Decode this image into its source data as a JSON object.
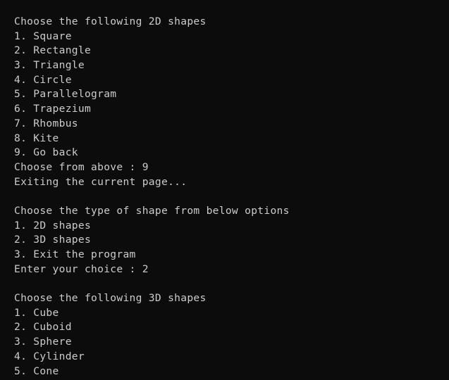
{
  "terminal": {
    "lines": [
      "Choose the following 2D shapes",
      "1. Square",
      "2. Rectangle",
      "3. Triangle",
      "4. Circle",
      "5. Parallelogram",
      "6. Trapezium",
      "7. Rhombus",
      "8. Kite",
      "9. Go back",
      "Choose from above : 9",
      "Exiting the current page...",
      "",
      "Choose the type of shape from below options",
      "1. 2D shapes",
      "2. 3D shapes",
      "3. Exit the program",
      "Enter your choice : 2",
      "",
      "Choose the following 3D shapes",
      "1. Cube",
      "2. Cuboid",
      "3. Sphere",
      "4. Cylinder",
      "5. Cone"
    ]
  },
  "colors": {
    "background": "#0c0c0c",
    "foreground": "#cccccc"
  }
}
